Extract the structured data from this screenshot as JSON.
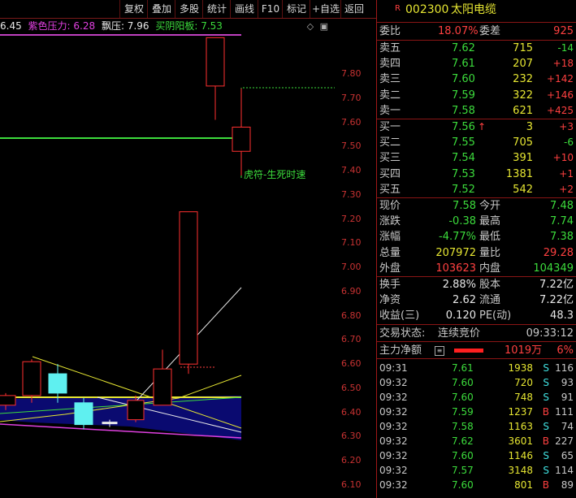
{
  "toolbar": {
    "buttons": [
      "复权",
      "叠加",
      "多股",
      "统计",
      "画线",
      "F10",
      "标记",
      "+自选",
      "返回"
    ]
  },
  "legend": {
    "prefix": "6.45",
    "items": [
      {
        "label": "紫色压力: 6.28",
        "color": "#e040e0"
      },
      {
        "label": "飘压: 7.96",
        "color": "#e8e8e8"
      },
      {
        "label": "买阴阳板: 7.53",
        "color": "#3cdc3c"
      }
    ],
    "icons": [
      "◇",
      "▣"
    ]
  },
  "chart": {
    "annotation": "虎符-生死时速",
    "price_ticks": [
      "7.80",
      "7.70",
      "7.60",
      "7.50",
      "7.40",
      "7.30",
      "7.20",
      "7.10",
      "7.00",
      "6.90",
      "6.80",
      "6.70",
      "6.60",
      "6.50",
      "6.40",
      "6.30",
      "6.20",
      "6.10"
    ],
    "ymin": 6.07,
    "ymax": 7.89,
    "candles": [
      {
        "o": 6.43,
        "c": 6.47,
        "h": 6.48,
        "l": 6.41,
        "color": "red"
      },
      {
        "o": 6.47,
        "c": 6.61,
        "h": 6.62,
        "l": 6.44,
        "color": "red"
      },
      {
        "o": 6.56,
        "c": 6.48,
        "h": 6.6,
        "l": 6.44,
        "color": "cyan"
      },
      {
        "o": 6.44,
        "c": 6.35,
        "h": 6.46,
        "l": 6.33,
        "color": "cyan"
      },
      {
        "o": 6.36,
        "c": 6.36,
        "h": 6.37,
        "l": 6.34,
        "color": "white"
      },
      {
        "o": 6.37,
        "c": 6.45,
        "h": 6.47,
        "l": 6.36,
        "color": "red"
      },
      {
        "o": 6.43,
        "c": 6.58,
        "h": 6.66,
        "l": 6.43,
        "color": "red"
      },
      {
        "o": 6.6,
        "c": 7.23,
        "h": 7.23,
        "l": 6.56,
        "color": "red"
      },
      {
        "o": 7.75,
        "c": 7.95,
        "h": 7.95,
        "l": 7.61,
        "color": "red"
      },
      {
        "o": 7.48,
        "c": 7.58,
        "h": 7.74,
        "l": 7.38,
        "color": "red"
      }
    ]
  },
  "quote": {
    "code": "002300",
    "name": "太阳电缆",
    "webi_label": "委比",
    "webi_value": "18.07%",
    "wecha_label": "委差",
    "wecha_value": "925",
    "asks": [
      {
        "label": "卖五",
        "price": "7.62",
        "vol": "715",
        "chg": "-14"
      },
      {
        "label": "卖四",
        "price": "7.61",
        "vol": "207",
        "chg": "+18"
      },
      {
        "label": "卖三",
        "price": "7.60",
        "vol": "232",
        "chg": "+142"
      },
      {
        "label": "卖二",
        "price": "7.59",
        "vol": "322",
        "chg": "+146"
      },
      {
        "label": "卖一",
        "price": "7.58",
        "vol": "621",
        "chg": "+425"
      }
    ],
    "bids": [
      {
        "label": "买一",
        "price": "7.56",
        "vol": "3",
        "chg": "+3",
        "arrow": "↑"
      },
      {
        "label": "买二",
        "price": "7.55",
        "vol": "705",
        "chg": "-6",
        "arrow": ""
      },
      {
        "label": "买三",
        "price": "7.54",
        "vol": "391",
        "chg": "+10",
        "arrow": ""
      },
      {
        "label": "买四",
        "price": "7.53",
        "vol": "1381",
        "chg": "+1",
        "arrow": ""
      },
      {
        "label": "买五",
        "price": "7.52",
        "vol": "542",
        "chg": "+2",
        "arrow": ""
      }
    ],
    "stats": [
      {
        "l1": "现价",
        "v1": "7.58",
        "c1": "green",
        "l2": "今开",
        "v2": "7.48",
        "c2": "green"
      },
      {
        "l1": "涨跌",
        "v1": "-0.38",
        "c1": "green",
        "l2": "最高",
        "v2": "7.74",
        "c2": "green"
      },
      {
        "l1": "涨幅",
        "v1": "-4.77%",
        "c1": "green",
        "l2": "最低",
        "v2": "7.38",
        "c2": "green"
      },
      {
        "l1": "总量",
        "v1": "207972",
        "c1": "yellow",
        "l2": "量比",
        "v2": "29.28",
        "c2": "red"
      },
      {
        "l1": "外盘",
        "v1": "103623",
        "c1": "red",
        "l2": "内盘",
        "v2": "104349",
        "c2": "green"
      }
    ],
    "stats2": [
      {
        "l1": "换手",
        "v1": "2.88%",
        "l2": "股本",
        "v2": "7.22亿"
      },
      {
        "l1": "净资",
        "v1": "2.62",
        "l2": "流通",
        "v2": "7.22亿"
      },
      {
        "l1": "收益(三)",
        "v1": "0.120",
        "l2": "PE(动)",
        "v2": "48.3"
      }
    ],
    "status_label": "交易状态:",
    "status_value": "连续竞价",
    "status_time": "09:33:12",
    "mainflow_label": "主力净额",
    "mainflow_value": "1019万",
    "mainflow_pct": "6%",
    "ticks": [
      {
        "t": "09:31",
        "p": "7.61",
        "v": "1938",
        "s": "S",
        "n": "116"
      },
      {
        "t": "09:32",
        "p": "7.60",
        "v": "720",
        "s": "S",
        "n": "93"
      },
      {
        "t": "09:32",
        "p": "7.60",
        "v": "748",
        "s": "S",
        "n": "91"
      },
      {
        "t": "09:32",
        "p": "7.59",
        "v": "1237",
        "s": "B",
        "n": "111"
      },
      {
        "t": "09:32",
        "p": "7.58",
        "v": "1163",
        "s": "S",
        "n": "74"
      },
      {
        "t": "09:32",
        "p": "7.62",
        "v": "3601",
        "s": "B",
        "n": "227"
      },
      {
        "t": "09:32",
        "p": "7.60",
        "v": "1146",
        "s": "S",
        "n": "65"
      },
      {
        "t": "09:32",
        "p": "7.57",
        "v": "3148",
        "s": "S",
        "n": "114"
      },
      {
        "t": "09:32",
        "p": "7.60",
        "v": "801",
        "s": "B",
        "n": "89"
      }
    ]
  }
}
